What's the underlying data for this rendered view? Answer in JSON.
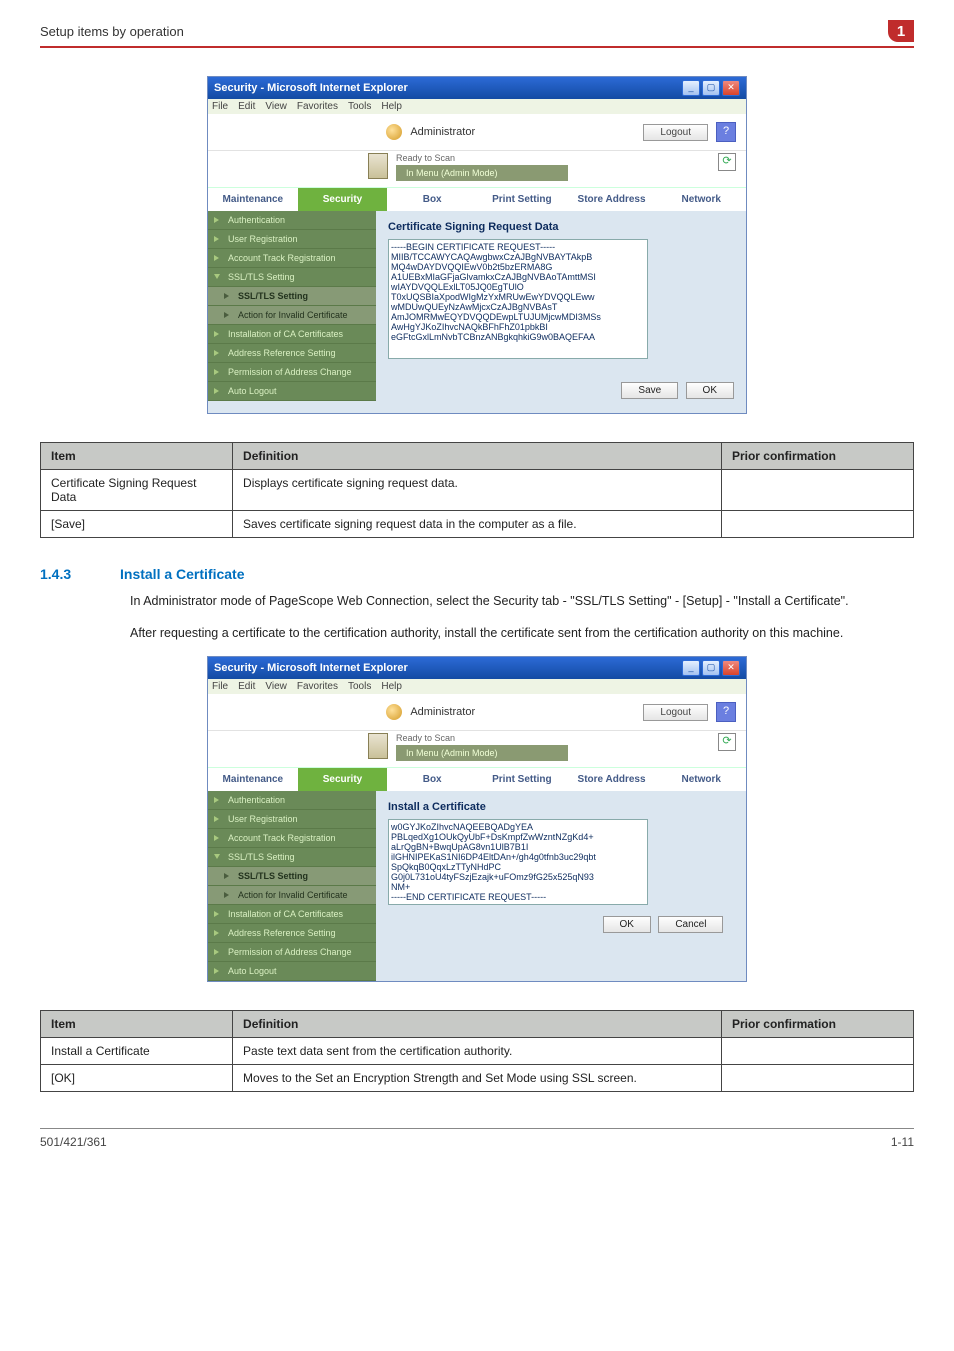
{
  "header": {
    "title": "Setup items by operation",
    "badge": "1"
  },
  "win": {
    "title": "Security - Microsoft Internet Explorer",
    "menus": [
      "File",
      "Edit",
      "View",
      "Favorites",
      "Tools",
      "Help"
    ],
    "admin": "Administrator",
    "logout": "Logout",
    "ready": "Ready to Scan",
    "mode": "In Menu (Admin Mode)"
  },
  "tabs": [
    "Maintenance",
    "Security",
    "Box",
    "Print Setting",
    "Store Address",
    "Network"
  ],
  "sidebar": {
    "items": [
      "Authentication",
      "User Registration",
      "Account Track Registration",
      "SSL/TLS Setting",
      "SSL/TLS Setting",
      "Action for Invalid Certificate",
      "Installation of CA Certificates",
      "Address Reference Setting",
      "Permission of Address Change",
      "Auto Logout"
    ]
  },
  "shot1": {
    "title": "Certificate Signing Request Data",
    "content": "-----BEGIN CERTIFICATE REQUEST-----\nMIIB/TCCAWYCAQAwgbwxCzAJBgNVBAYTAkpB\nMQ4wDAYDVQQIEwV0b2t5bzERMA8G\nA1UEBxMIaGFjaGlvamkxCzAJBgNVBAoTAmttMSI\nwIAYDVQQLExlLT05JQ0EgTUlO\nT0xUQSBIaXpodWIgMzYxMRUwEwYDVQQLEww\nwMDUwQUEyNzAwMjcxCzAJBgNVBAsT\nAmJOMRMwEQYDVQQDEwpLTUJUMjcwMDI3MSs\nAwHgYJKoZIhvcNAQkBFhFhZ01pbkBI\neGFtcGxlLmNvbTCBnzANBgkqhkiG9w0BAQEFAA",
    "save": "Save",
    "ok": "OK"
  },
  "table1": {
    "h_item": "Item",
    "h_def": "Definition",
    "h_prior": "Prior confirmation",
    "rows": [
      {
        "item": "Certificate Signing Request Data",
        "def": "Displays certificate signing request data.",
        "prior": ""
      },
      {
        "item": "[Save]",
        "def": "Saves certificate signing request data in the computer as a file.",
        "prior": ""
      }
    ]
  },
  "section": {
    "num": "1.4.3",
    "title": "Install a Certificate",
    "p1": "In Administrator mode of PageScope Web Connection, select the Security tab - \"SSL/TLS Setting\" - [Setup] - \"Install a Certificate\".",
    "p2": "After requesting a certificate to the certification authority, install the certificate sent from the certification authority on this machine."
  },
  "shot2": {
    "title": "Install a Certificate",
    "content": "w0GYJKoZIhvcNAQEEBQADgYEA\nPBLqedXg1OUkQyUbF+DsKmpfZwWzntNZgKd4+\naLrQgBN+BwqUpAG8vn1UlB7B1I\nilGHNIPEKaS1NI6DP4EltDAn+/gh4g0tfnb3uc29qbt\nSpQkqB0QqxLzTTyNHdPC\nG0j0L731oU4tyFSzjEzajk+uFOmz9fG25x525qN93\nNM+\n-----END CERTIFICATE REQUEST-----",
    "ok": "OK",
    "cancel": "Cancel"
  },
  "table2": {
    "h_item": "Item",
    "h_def": "Definition",
    "h_prior": "Prior confirmation",
    "rows": [
      {
        "item": "Install a Certificate",
        "def": "Paste text data sent from the certification authority.",
        "prior": ""
      },
      {
        "item": "[OK]",
        "def": "Moves to the Set an Encryption Strength and Set Mode using SSL screen.",
        "prior": ""
      }
    ]
  },
  "footer": {
    "left": "501/421/361",
    "right": "1-11"
  }
}
